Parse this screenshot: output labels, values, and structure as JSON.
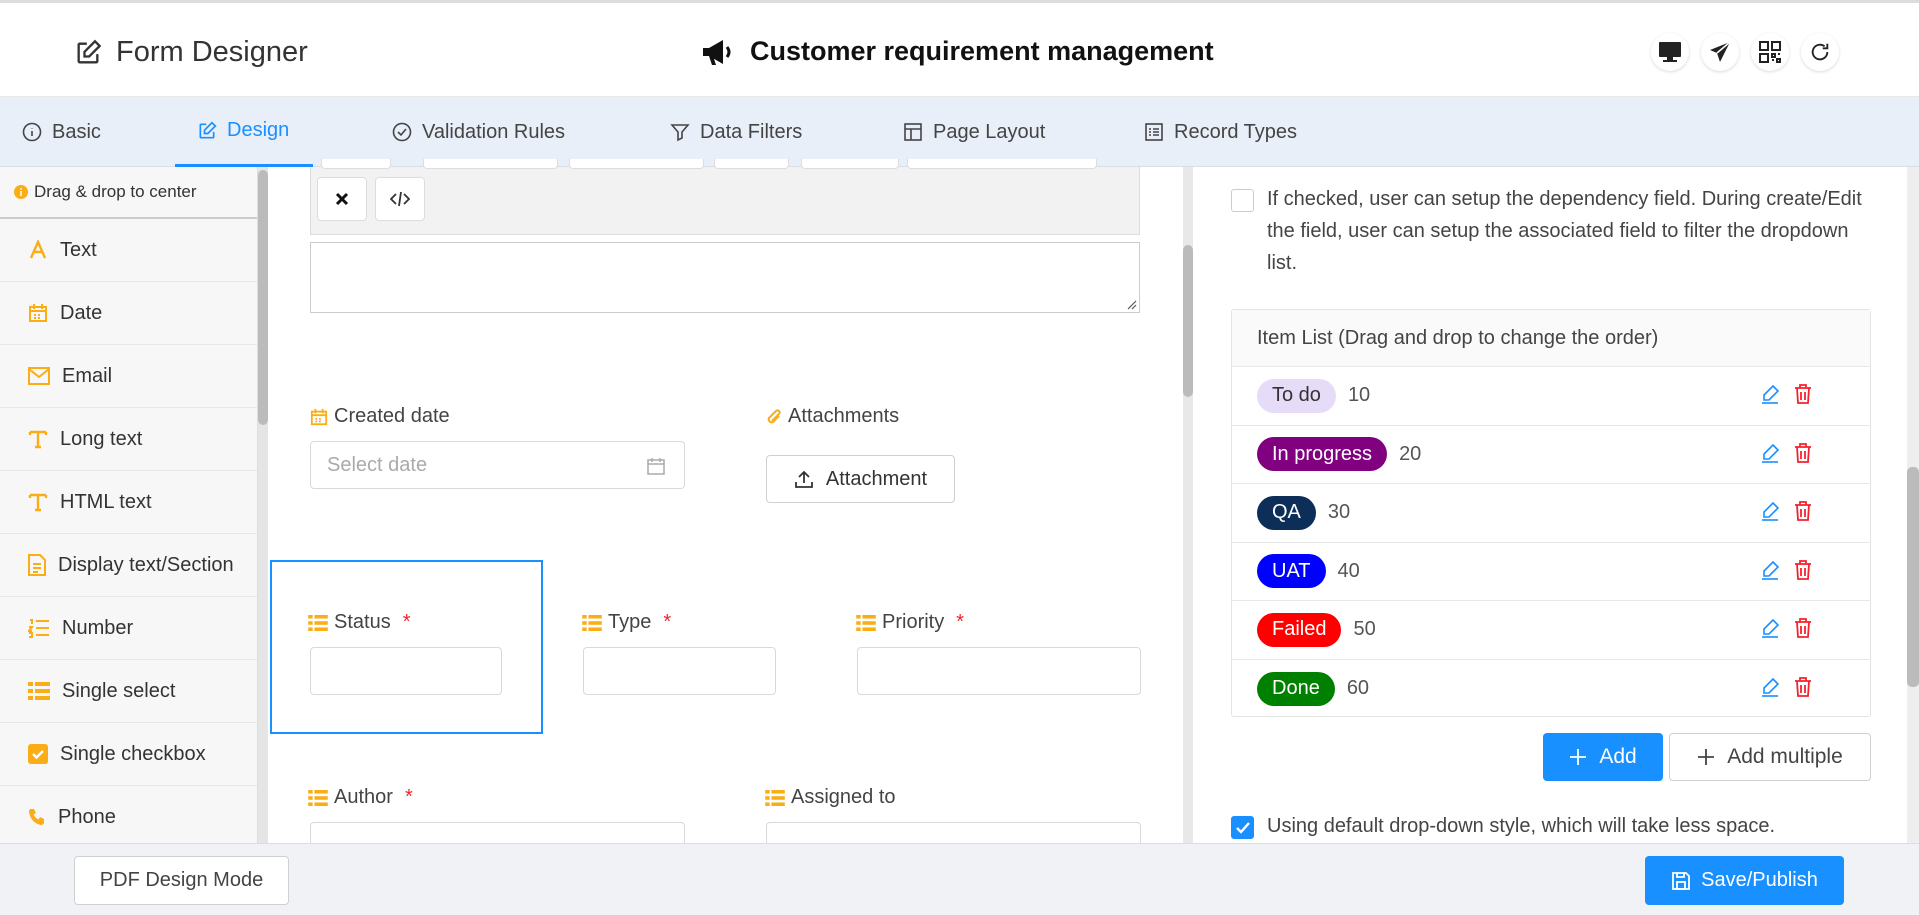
{
  "header": {
    "app_title": "Form Designer",
    "page_title": "Customer requirement management"
  },
  "tabs": [
    {
      "label": "Basic"
    },
    {
      "label": "Design"
    },
    {
      "label": "Validation Rules"
    },
    {
      "label": "Data Filters"
    },
    {
      "label": "Page Layout"
    },
    {
      "label": "Record Types"
    }
  ],
  "sidebar": {
    "hint": "Drag & drop to center",
    "items": [
      {
        "label": "Text"
      },
      {
        "label": "Date"
      },
      {
        "label": "Email"
      },
      {
        "label": "Long text"
      },
      {
        "label": "HTML text"
      },
      {
        "label": "Display text/Section"
      },
      {
        "label": "Number"
      },
      {
        "label": "Single select"
      },
      {
        "label": "Single checkbox"
      },
      {
        "label": "Phone"
      }
    ]
  },
  "canvas": {
    "toolbar_icons": [
      "close-icon",
      "code-icon"
    ],
    "created_date": {
      "label": "Created date",
      "placeholder": "Select date"
    },
    "attachments": {
      "label": "Attachments",
      "button": "Attachment"
    },
    "status": {
      "label": "Status",
      "required": "*"
    },
    "type": {
      "label": "Type",
      "required": "*"
    },
    "priority": {
      "label": "Priority",
      "required": "*"
    },
    "author": {
      "label": "Author",
      "required": "*"
    },
    "assigned_to": {
      "label": "Assigned to"
    }
  },
  "properties": {
    "dependency_checked": false,
    "dependency_text": "If checked, user can setup the dependency field. During create/Edit the field, user can setup the associated field to filter the dropdown list.",
    "item_list_header": "Item List  (Drag and drop to change the order)",
    "items": [
      {
        "label": "To do",
        "value": "10",
        "bg": "#e6dcf7",
        "fg": "#333333"
      },
      {
        "label": "In progress",
        "value": "20",
        "bg": "#800080",
        "fg": "#ffffff"
      },
      {
        "label": "QA",
        "value": "30",
        "bg": "#0d2e59",
        "fg": "#ffffff"
      },
      {
        "label": "UAT",
        "value": "40",
        "bg": "#0000ff",
        "fg": "#ffffff"
      },
      {
        "label": "Failed",
        "value": "50",
        "bg": "#ff0000",
        "fg": "#ffffff"
      },
      {
        "label": "Done",
        "value": "60",
        "bg": "#008000",
        "fg": "#ffffff"
      }
    ],
    "add_label": "Add",
    "add_multiple_label": "Add multiple",
    "default_dropdown_checked": true,
    "default_dropdown_text": "Using default drop-down style, which will take less space."
  },
  "footer": {
    "pdf_mode_label": "PDF Design Mode",
    "save_label": "Save/Publish"
  },
  "colors": {
    "accent": "#1890ff",
    "icon_orange": "#faad14",
    "required": "#f5222d",
    "tab_bar": "#e8eff9"
  }
}
